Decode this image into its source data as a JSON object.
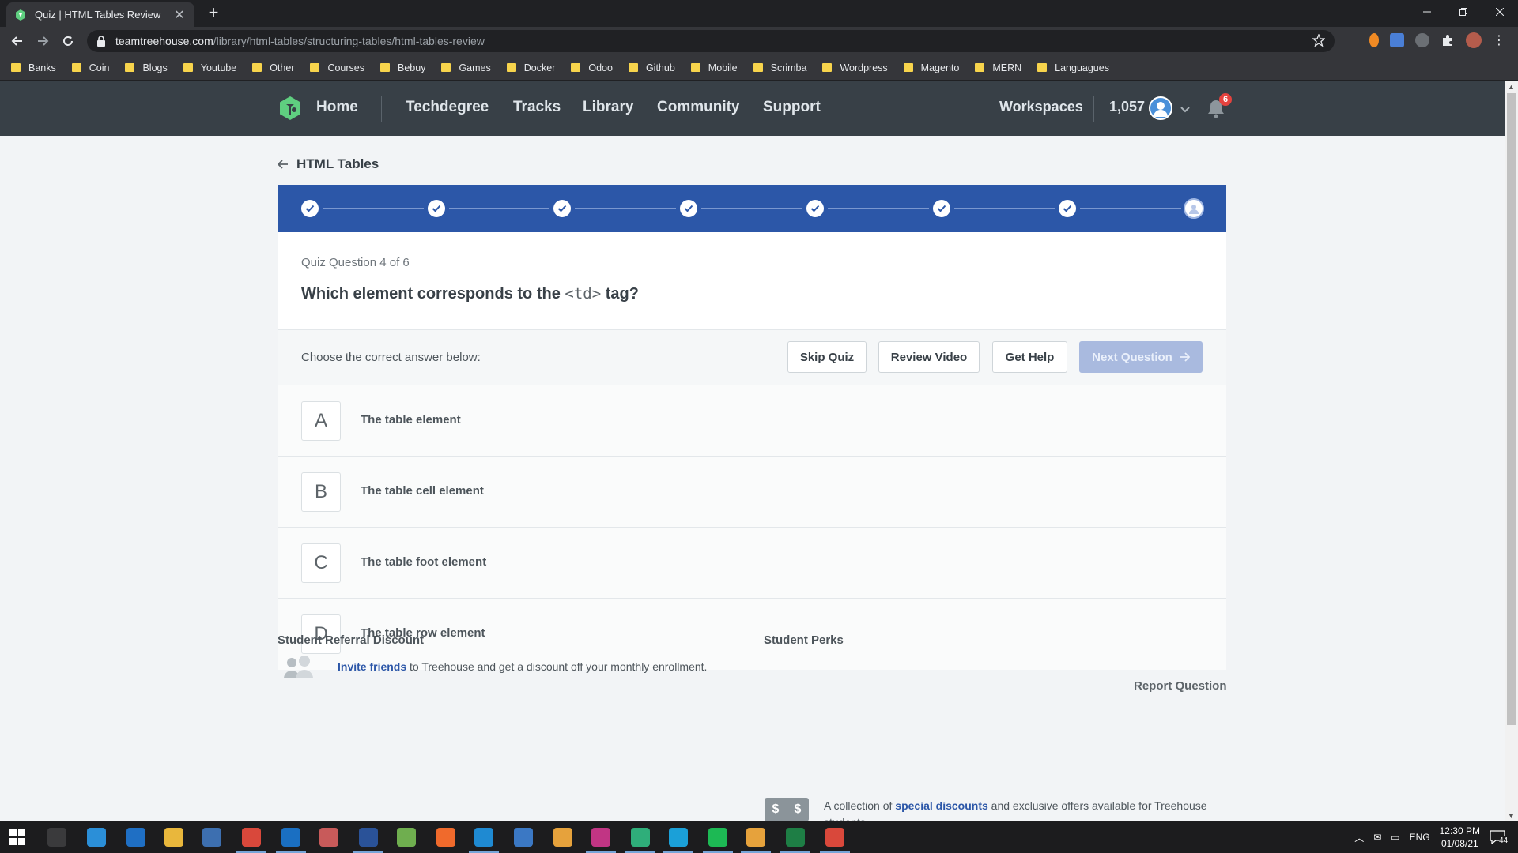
{
  "browser": {
    "tab_title": "Quiz | HTML Tables Review",
    "url_host": "teamtreehouse.com",
    "url_path": "/library/html-tables/structuring-tables/html-tables-review",
    "bookmarks": [
      "Banks",
      "Coin",
      "Blogs",
      "Youtube",
      "Other",
      "Courses",
      "Bebuy",
      "Games",
      "Docker",
      "Odoo",
      "Github",
      "Mobile",
      "Scrimba",
      "Wordpress",
      "Magento",
      "MERN",
      "Languagues"
    ]
  },
  "header": {
    "home": "Home",
    "techdegree": "Techdegree",
    "tracks": "Tracks",
    "library": "Library",
    "community": "Community",
    "support": "Support",
    "workspaces": "Workspaces",
    "points": "1,057",
    "notifications": "6"
  },
  "page": {
    "back_label": "HTML Tables",
    "progress": {
      "steps_total": 8,
      "steps_completed": 7
    },
    "quiz": {
      "question_number": "Quiz Question 4 of 6",
      "question_prefix": "Which element corresponds to the ",
      "question_code": "<td>",
      "question_suffix": " tag?",
      "choose_label": "Choose the correct answer below:",
      "skip_label": "Skip Quiz",
      "review_label": "Review Video",
      "help_label": "Get Help",
      "next_label": "Next Question",
      "answers": [
        {
          "letter": "A",
          "text": "The table element"
        },
        {
          "letter": "B",
          "text": "The table cell element"
        },
        {
          "letter": "C",
          "text": "The table foot element"
        },
        {
          "letter": "D",
          "text": "The table row element"
        }
      ]
    },
    "report_label": "Report Question",
    "footer": {
      "referral_title": "Student Referral Discount",
      "referral_link": "Invite friends",
      "referral_text": " to Treehouse and get a discount off your monthly enrollment.",
      "perks_title": "Student Perks",
      "perks_prefix": "A collection of ",
      "perks_link": "special discounts",
      "perks_text": " and exclusive offers available for Treehouse students."
    }
  },
  "taskbar": {
    "language": "ENG",
    "time": "12:30 PM",
    "date": "01/08/21",
    "notification_count": "44"
  },
  "colors": {
    "header_bg": "#384047",
    "progress_bg": "#2c57a8",
    "next_button_disabled": "#a9badf",
    "link": "#2c57a8"
  }
}
